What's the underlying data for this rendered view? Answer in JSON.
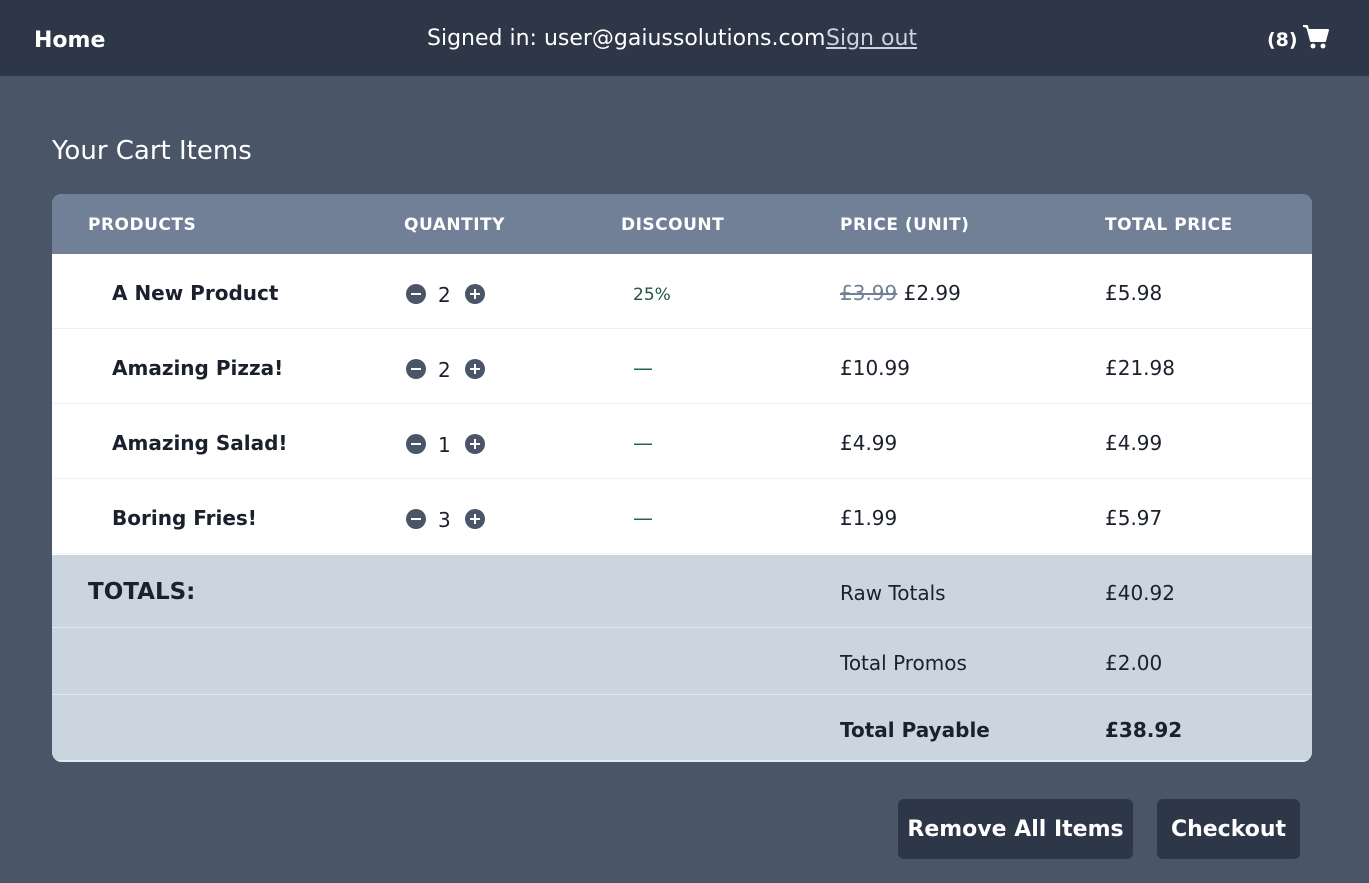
{
  "nav": {
    "home_label": "Home",
    "signed_in_text": "Signed in: user@gaiussolutions.com",
    "sign_out_label": "Sign out",
    "cart_count": "(8)",
    "cart_icon": "shopping-cart-icon"
  },
  "page_title": "Your Cart Items",
  "table": {
    "headers": [
      "PRODUCTS",
      "QUANTITY",
      "DISCOUNT",
      "PRICE (UNIT)",
      "TOTAL PRICE"
    ],
    "rows": [
      {
        "product": "A New Product",
        "quantity": "2",
        "discount": "25%",
        "old_price": "£3.99",
        "price": "£2.99",
        "total": "£5.98"
      },
      {
        "product": "Amazing Pizza!",
        "quantity": "2",
        "discount": "—",
        "old_price": "",
        "price": "£10.99",
        "total": "£21.98"
      },
      {
        "product": "Amazing Salad!",
        "quantity": "1",
        "discount": "—",
        "old_price": "",
        "price": "£4.99",
        "total": "£4.99"
      },
      {
        "product": "Boring Fries!",
        "quantity": "3",
        "discount": "—",
        "old_price": "",
        "price": "£1.99",
        "total": "£5.97"
      }
    ]
  },
  "totals": {
    "heading": "TOTALS:",
    "raw_label": "Raw Totals",
    "raw_value": "£40.92",
    "promos_label": "Total Promos",
    "promos_value": "£2.00",
    "payable_label": "Total Payable",
    "payable_value": "£38.92"
  },
  "actions": {
    "remove_all_label": "Remove All Items",
    "checkout_label": "Checkout"
  },
  "colors": {
    "header_bg": "#2d3748",
    "page_bg": "#4a5568",
    "table_head_bg": "#718096",
    "totals_bg": "#cbd5e0",
    "discount_text": "#22543d"
  }
}
